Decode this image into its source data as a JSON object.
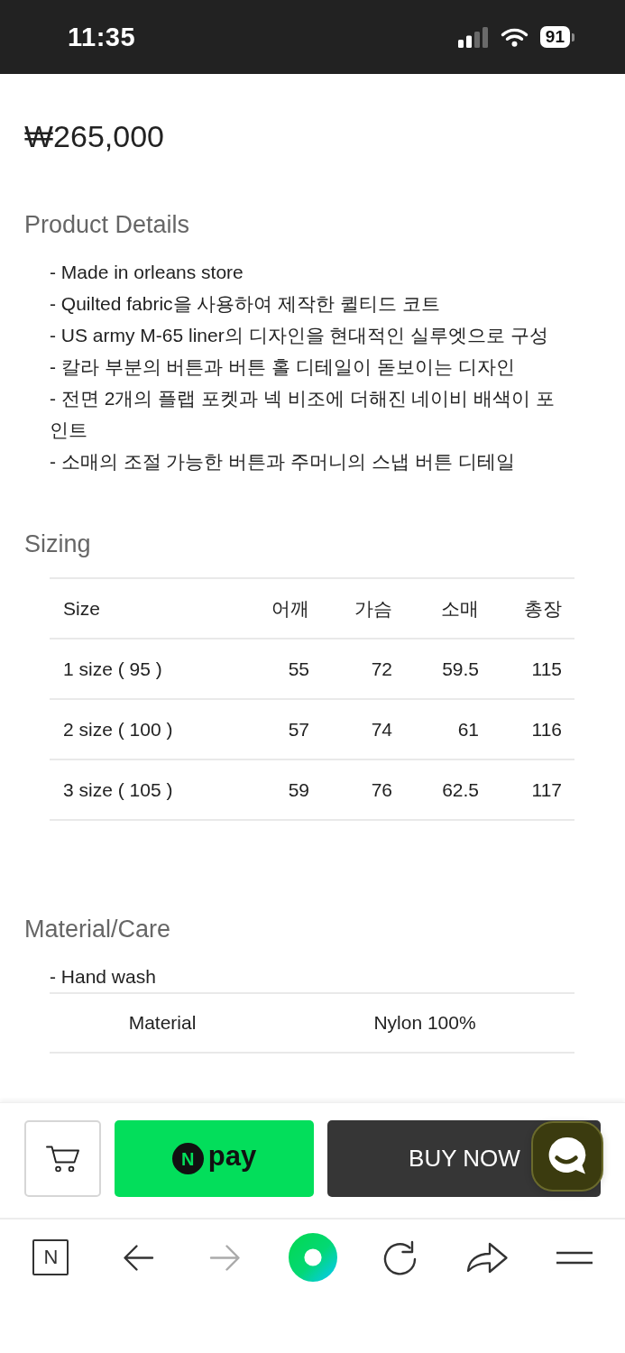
{
  "status_bar": {
    "time": "11:35",
    "battery": "91"
  },
  "product": {
    "price": "₩265,000"
  },
  "details": {
    "heading": "Product Details",
    "lines": [
      "- Made in orleans store",
      "- Quilted fabric을 사용하여 제작한 퀼티드 코트",
      "- US army M-65 liner의 디자인을 현대적인 실루엣으로 구성",
      "- 칼라 부분의 버튼과 버튼 홀 디테일이 돋보이는 디자인",
      "- 전면 2개의 플랩 포켓과 넥 비조에 더해진 네이비 배색이 포인트",
      "- 소매의 조절 가능한 버튼과 주머니의 스냅 버튼 디테일"
    ]
  },
  "sizing": {
    "heading": "Sizing",
    "columns": [
      "Size",
      "어깨",
      "가슴",
      "소매",
      "총장"
    ],
    "rows": [
      [
        "1 size ( 95 )",
        "55",
        "72",
        "59.5",
        "115"
      ],
      [
        "2 size ( 100 )",
        "57",
        "74",
        "61",
        "116"
      ],
      [
        "3 size ( 105 )",
        "59",
        "76",
        "62.5",
        "117"
      ]
    ]
  },
  "material_care": {
    "heading": "Material/Care",
    "notes": [
      "- Hand wash"
    ],
    "rows": [
      [
        "Material",
        "Nylon 100%"
      ]
    ]
  },
  "purchase_bar": {
    "npay": {
      "logo": "N",
      "label": "pay"
    },
    "buy_now": "BUY NOW"
  },
  "browser_toolbar": {
    "buttons": [
      {
        "kind": "logo",
        "label": "N",
        "disabled": false
      },
      {
        "kind": "back",
        "disabled": false
      },
      {
        "kind": "forward",
        "disabled": true
      },
      {
        "kind": "ring",
        "disabled": false
      },
      {
        "kind": "reload",
        "disabled": false
      },
      {
        "kind": "share",
        "disabled": false
      },
      {
        "kind": "menu",
        "disabled": false
      }
    ]
  }
}
